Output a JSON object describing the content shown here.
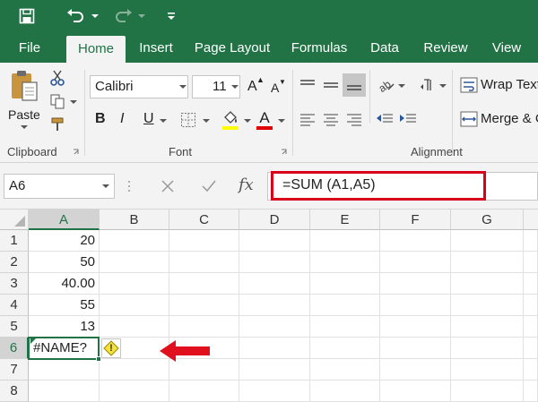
{
  "ribbon_tabs": {
    "file": "File",
    "home": "Home",
    "insert": "Insert",
    "page_layout": "Page Layout",
    "formulas": "Formulas",
    "data": "Data",
    "review": "Review",
    "view": "View"
  },
  "clipboard": {
    "paste_label": "Paste",
    "group_label": "Clipboard"
  },
  "font": {
    "name": "Calibri",
    "size": "11",
    "group_label": "Font",
    "bold": "B",
    "italic": "I",
    "underline": "U",
    "grow": "A",
    "shrink": "A",
    "color_glyph": "A",
    "colors": {
      "highlight": "#ffff00",
      "font_color": "#e00000"
    }
  },
  "alignment": {
    "wrap_text": "Wrap Text",
    "merge": "Merge & C",
    "group_label": "Alignment"
  },
  "formula_bar": {
    "name_box": "A6",
    "formula": "=SUM (A1,A5)",
    "fx": "fx",
    "highlight_color": "#d9001b"
  },
  "sheet": {
    "columns": [
      "A",
      "B",
      "C",
      "D",
      "E",
      "F",
      "G"
    ],
    "rows": [
      "1",
      "2",
      "3",
      "4",
      "5",
      "6",
      "7",
      "8"
    ],
    "cells": {
      "A1": "20",
      "A2": "50",
      "A3": "40.00",
      "A4": "55",
      "A5": "13",
      "A6": "#NAME?"
    },
    "selected_cell": "A6",
    "error_glyph": "!",
    "arrow_color": "#e0101e"
  },
  "icons": [
    "save-icon",
    "undo-icon",
    "redo-icon",
    "customize-qat-icon",
    "paste-icon",
    "cut-icon",
    "copy-icon",
    "format-painter-icon",
    "border-icon",
    "fill-color-icon",
    "font-color-icon",
    "align-top-icon",
    "align-middle-icon",
    "align-bottom-icon",
    "orientation-icon",
    "wrap-text-icon",
    "align-left-icon",
    "center-icon",
    "align-right-icon",
    "decrease-indent-icon",
    "increase-indent-icon",
    "merge-icon",
    "cancel-icon",
    "enter-icon",
    "error-warning-icon",
    "arrow-icon"
  ]
}
